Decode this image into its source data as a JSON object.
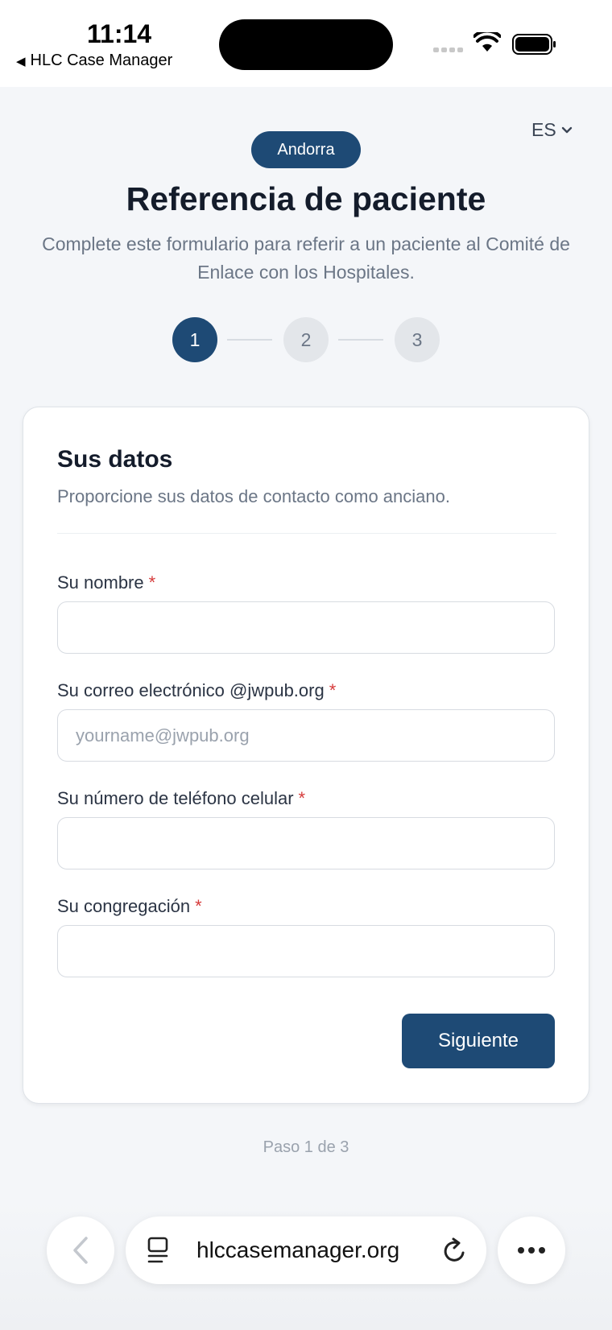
{
  "status_bar": {
    "time": "11:14",
    "back_app": "HLC Case Manager"
  },
  "header": {
    "language": "ES",
    "country": "Andorra",
    "title": "Referencia de paciente",
    "subtitle": "Complete este formulario para referir a un paciente al Comité de Enlace con los Hospitales."
  },
  "steps": {
    "items": [
      "1",
      "2",
      "3"
    ],
    "current": 1,
    "footer": "Paso 1 de 3"
  },
  "form": {
    "title": "Sus datos",
    "subtitle": "Proporcione sus datos de contacto como anciano.",
    "required_mark": "*",
    "fields": [
      {
        "label": "Su nombre",
        "value": "",
        "placeholder": ""
      },
      {
        "label": "Su correo electrónico @jwpub.org",
        "value": "",
        "placeholder": "yourname@jwpub.org"
      },
      {
        "label": "Su número de teléfono celular",
        "value": "",
        "placeholder": ""
      },
      {
        "label": "Su congregación",
        "value": "",
        "placeholder": ""
      }
    ],
    "next_label": "Siguiente"
  },
  "browser": {
    "url": "hlccasemanager.org"
  },
  "colors": {
    "primary": "#1e4a75",
    "required": "#d63a3a",
    "background": "#f4f6f9"
  }
}
